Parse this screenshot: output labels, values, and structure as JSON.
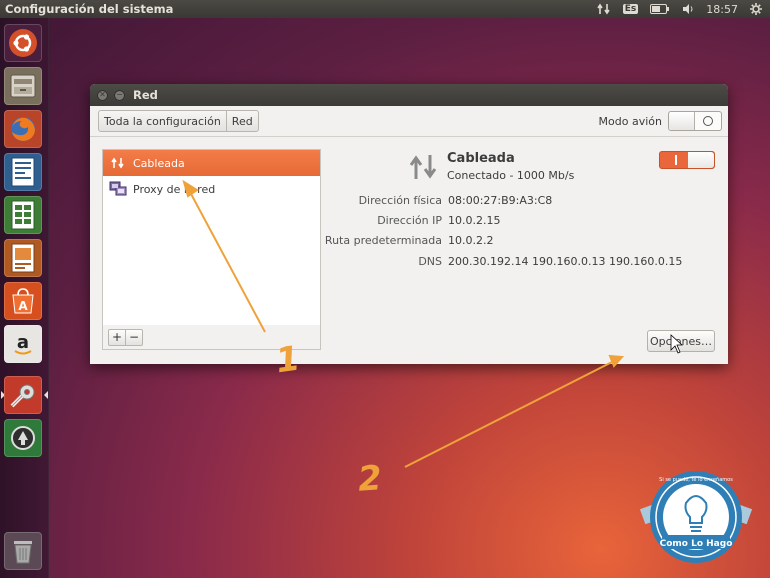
{
  "topbar": {
    "app_title": "Configuración del sistema",
    "keyboard": "Es",
    "clock": "18:57"
  },
  "window": {
    "title": "Red",
    "breadcrumbs": [
      "Toda la configuración",
      "Red"
    ],
    "airplane_label": "Modo avión"
  },
  "sidebar": {
    "items": [
      {
        "label": "Cableada",
        "icon": "network-arrows-icon",
        "selected": true
      },
      {
        "label": "Proxy de la red",
        "icon": "proxy-icon",
        "selected": false
      }
    ],
    "add_label": "+",
    "remove_label": "−"
  },
  "detail": {
    "name": "Cableada",
    "status": "Conectado - 1000 Mb/s",
    "props": [
      {
        "key": "Dirección física",
        "value": "08:00:27:B9:A3:C8"
      },
      {
        "key": "Dirección IP",
        "value": "10.0.2.15"
      },
      {
        "key": "Ruta predeterminada",
        "value": "10.0.2.2"
      },
      {
        "key": "DNS",
        "value": "200.30.192.14 190.160.0.13 190.160.0.15"
      }
    ],
    "options_label": "Opciones…"
  },
  "annotations": {
    "one": "1",
    "two": "2"
  },
  "watermark": {
    "text": "Como Lo Hago",
    "ring_text": "Si se puede, te lo enseñamos"
  },
  "colors": {
    "accent": "#e9673a",
    "annotation": "#f0a23a"
  }
}
